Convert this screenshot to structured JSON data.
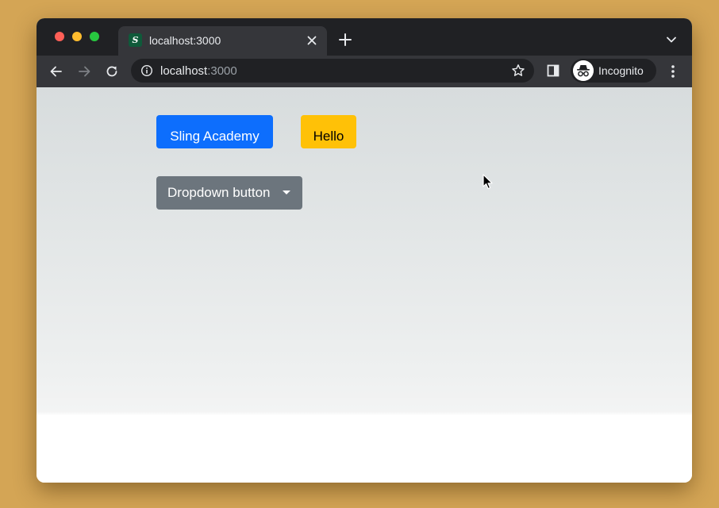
{
  "browser": {
    "tab": {
      "favicon_letter": "S",
      "title": "localhost:3000"
    },
    "address_bar": {
      "host": "localhost",
      "port": ":3000"
    },
    "profile": {
      "label": "Incognito"
    },
    "icons": [
      "close-red-dot-icon",
      "minimize-yellow-dot-icon",
      "zoom-green-dot-icon",
      "close-icon",
      "plus-icon",
      "chevron-down-icon",
      "arrow-left-icon",
      "arrow-right-icon",
      "reload-icon",
      "info-icon",
      "star-icon",
      "side-panel-icon",
      "incognito-icon",
      "kebab-menu-icon",
      "mouse-cursor-icon"
    ]
  },
  "page": {
    "buttons": {
      "primary_label": "Sling Academy",
      "warning_label": "Hello",
      "dropdown_label": "Dropdown button"
    }
  },
  "colors": {
    "primary": "#0d6efd",
    "warning": "#ffc107",
    "secondary": "#6c757d",
    "chrome_dark": "#202124",
    "chrome_toolbar": "#35363a",
    "desktop": "#d4a555"
  }
}
